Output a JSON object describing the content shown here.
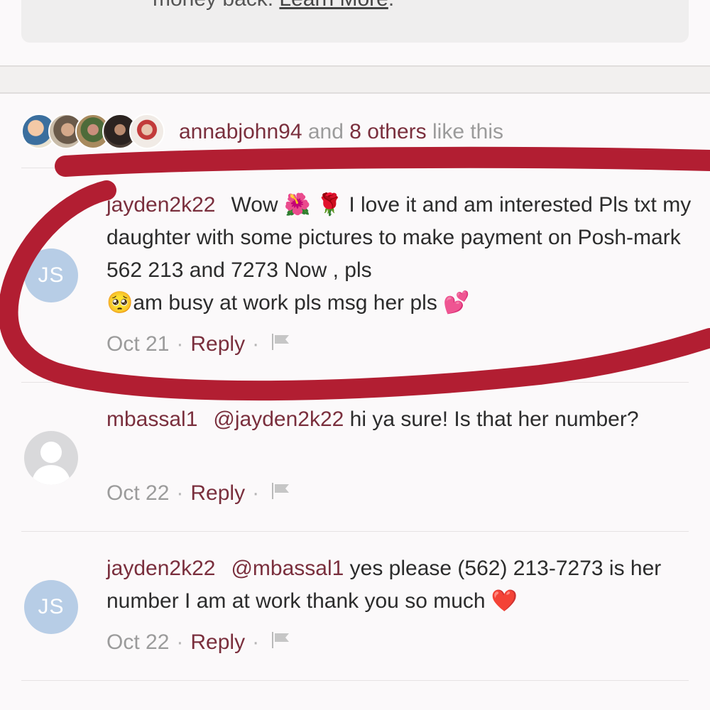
{
  "top_card": {
    "text": "money back. ",
    "link": "Learn More",
    "end": "."
  },
  "likes": {
    "user": "annabjohn94",
    "and_text": " and ",
    "others": "8 others",
    "suffix": " like this"
  },
  "comments": [
    {
      "initials": "JS",
      "username": "jayden2k22",
      "text_before_emoji": "Wow ",
      "emoji_1": "🌺",
      "emoji_2": "🌹",
      "text": " I love it and am interested Pls txt my daughter with some pictures to make payment  on Posh-mark 562 213 and 7273   Now , pls ",
      "emoji_3": "🥺",
      "text_end": "am busy at work pls msg her pls ",
      "emoji_4": "💕",
      "date": "Oct 21",
      "reply": "Reply"
    },
    {
      "initials": "",
      "username": "mbassal1",
      "mention": "@jayden2k22",
      "text": " hi ya sure! Is that her number?",
      "date": "Oct 22",
      "reply": "Reply"
    },
    {
      "initials": "JS",
      "username": "jayden2k22",
      "mention": "@mbassal1",
      "text": " yes please (562) 213-7273 is her number I am at work thank you so much ",
      "emoji": "❤️",
      "date": "Oct 22",
      "reply": "Reply"
    }
  ],
  "colors": {
    "accent": "#7a2f3d",
    "marker": "#b21e32",
    "avatar_initials_bg": "#b7cde6"
  }
}
